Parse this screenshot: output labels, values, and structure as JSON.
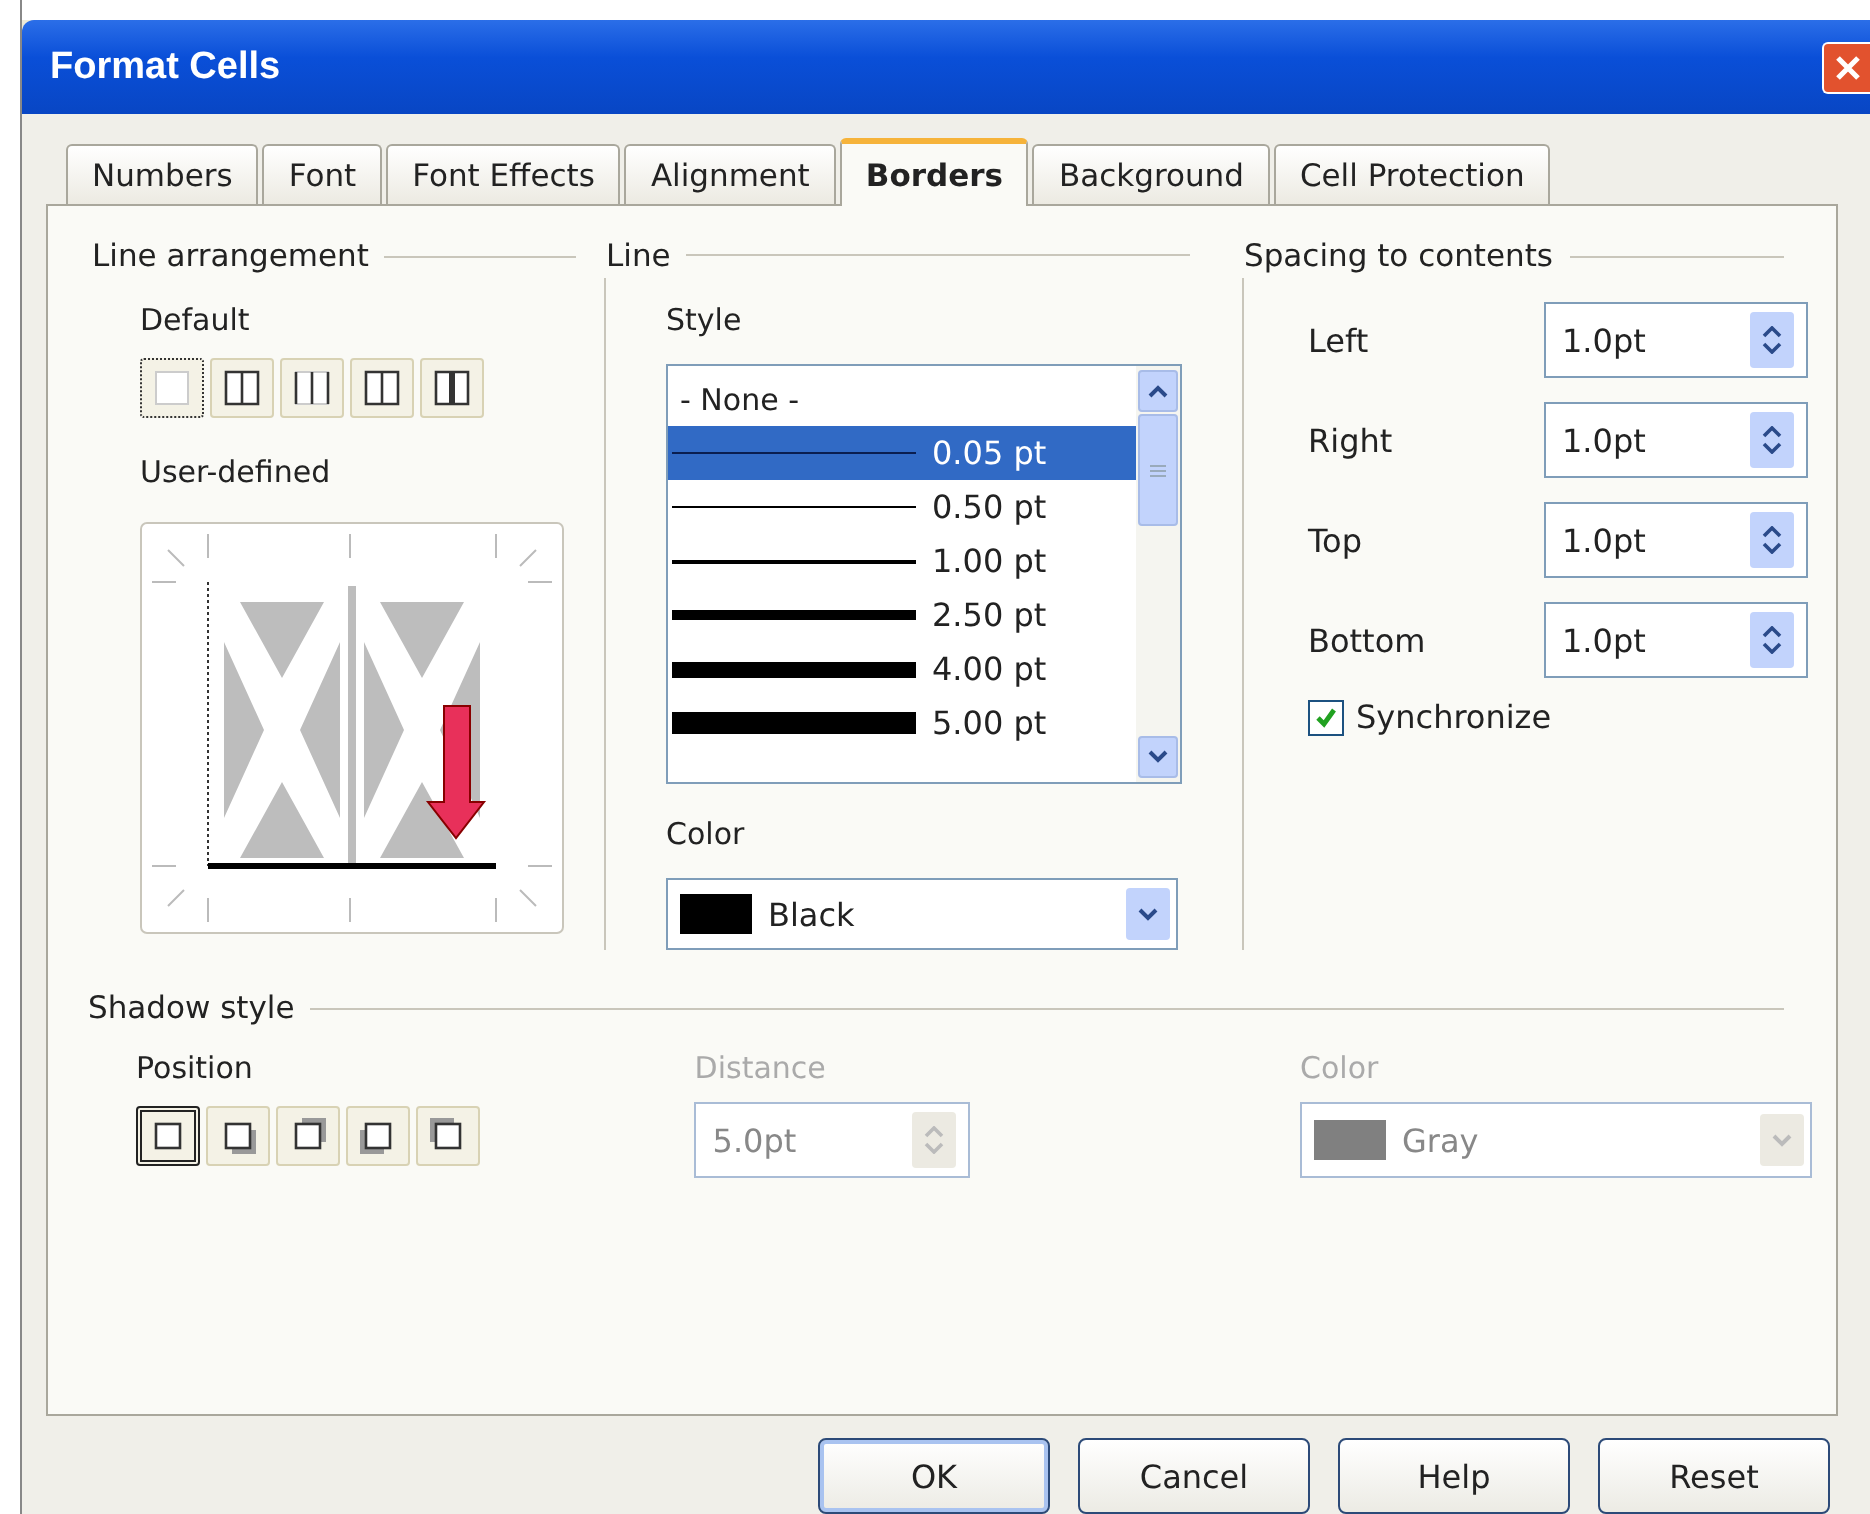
{
  "window": {
    "title": "Format Cells"
  },
  "tabs": [
    {
      "label": "Numbers",
      "selected": false
    },
    {
      "label": "Font",
      "selected": false
    },
    {
      "label": "Font Effects",
      "selected": false
    },
    {
      "label": "Alignment",
      "selected": false
    },
    {
      "label": "Borders",
      "selected": true
    },
    {
      "label": "Background",
      "selected": false
    },
    {
      "label": "Cell Protection",
      "selected": false
    }
  ],
  "line_arrangement": {
    "title": "Line arrangement",
    "default_label": "Default",
    "presets": [
      {
        "kind": "none",
        "selected": true
      },
      {
        "kind": "outer",
        "selected": false
      },
      {
        "kind": "outer-vertical",
        "selected": false
      },
      {
        "kind": "outer-all",
        "selected": false
      },
      {
        "kind": "outer-thick",
        "selected": false
      }
    ],
    "user_defined_label": "User-defined"
  },
  "line": {
    "title": "Line",
    "style_label": "Style",
    "styles": [
      {
        "label": "- None -",
        "kind": "none",
        "selected": false
      },
      {
        "label": "0.05 pt",
        "kind": "hairline",
        "selected": true
      },
      {
        "label": "0.50 pt",
        "kind": "thin",
        "selected": false
      },
      {
        "label": "1.00 pt",
        "kind": "medium",
        "selected": false
      },
      {
        "label": "2.50 pt",
        "kind": "thick",
        "selected": false
      },
      {
        "label": "4.00 pt",
        "kind": "heavy",
        "selected": false
      },
      {
        "label": "5.00 pt",
        "kind": "extra-heavy",
        "selected": false
      }
    ],
    "color_label": "Color",
    "color": {
      "value": "Black",
      "color": "#000000"
    }
  },
  "spacing": {
    "title": "Spacing to contents",
    "fields": [
      {
        "label": "Left",
        "value": "1.0pt"
      },
      {
        "label": "Right",
        "value": "1.0pt"
      },
      {
        "label": "Top",
        "value": "1.0pt"
      },
      {
        "label": "Bottom",
        "value": "1.0pt"
      }
    ],
    "synchronize": {
      "label": "Synchronize",
      "checked": true
    }
  },
  "shadow": {
    "title": "Shadow style",
    "position_label": "Position",
    "positions": [
      {
        "kind": "none",
        "selected": true
      },
      {
        "kind": "bottom-right",
        "selected": false
      },
      {
        "kind": "top-right",
        "selected": false
      },
      {
        "kind": "bottom-left",
        "selected": false
      },
      {
        "kind": "top-left",
        "selected": false
      }
    ],
    "distance_label": "Distance",
    "distance_value": "5.0pt",
    "distance_disabled": true,
    "color_label": "Color",
    "color_value": "Gray",
    "color": "#808080",
    "color_disabled": true
  },
  "buttons": [
    {
      "label": "OK",
      "default": true
    },
    {
      "label": "Cancel",
      "default": false
    },
    {
      "label": "Help",
      "default": false
    },
    {
      "label": "Reset",
      "default": false
    }
  ]
}
